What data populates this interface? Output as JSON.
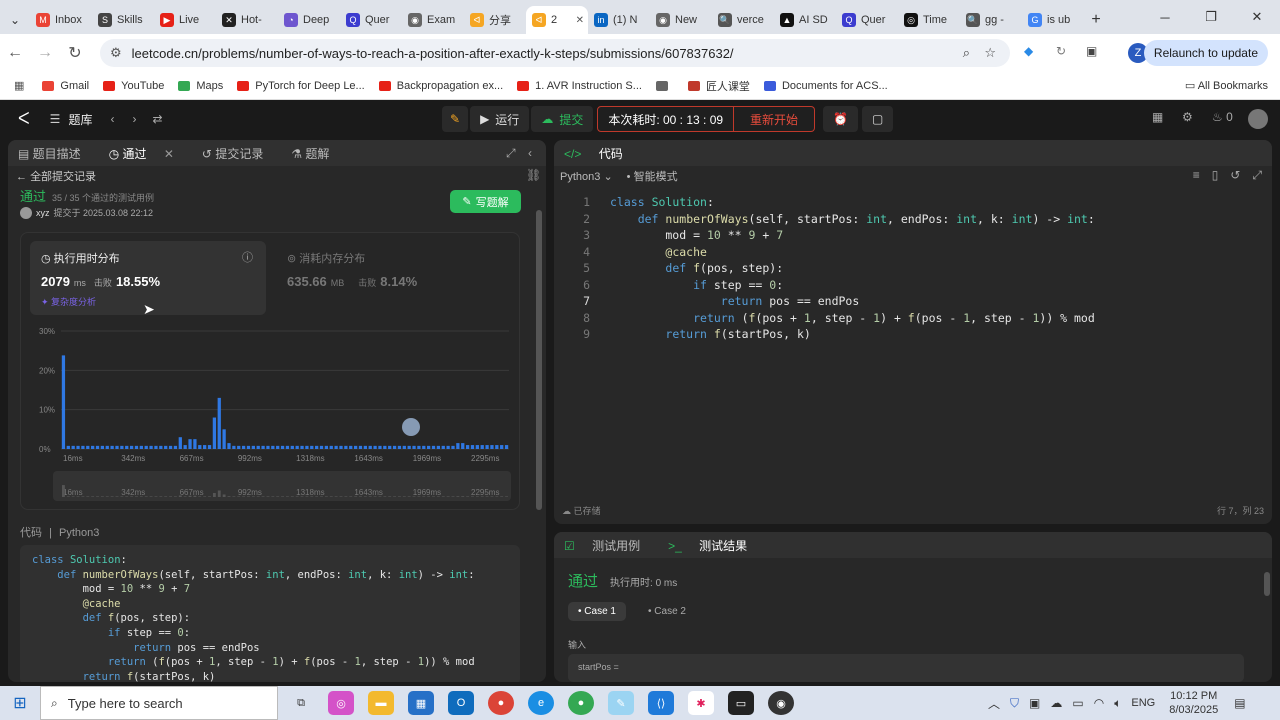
{
  "browser": {
    "tabs": [
      {
        "label": "Inbox",
        "color": "#ea4335",
        "glyph": "M"
      },
      {
        "label": "Skills",
        "color": "#444",
        "glyph": "S"
      },
      {
        "label": "Live",
        "color": "#e62117",
        "glyph": "▶"
      },
      {
        "label": "Hot-",
        "color": "#222",
        "glyph": "✕"
      },
      {
        "label": "Deep",
        "color": "#6e56cf",
        "glyph": "◔"
      },
      {
        "label": "Quer",
        "color": "#3c3ccf",
        "glyph": "Q"
      },
      {
        "label": "Exam",
        "color": "#666",
        "glyph": "◉"
      },
      {
        "label": "分享",
        "color": "#f5a623",
        "glyph": "ᐊ"
      },
      {
        "label": "2",
        "color": "#f5a623",
        "glyph": "ᐊ",
        "active": true
      },
      {
        "label": "(1) N",
        "color": "#0a66c2",
        "glyph": "in"
      },
      {
        "label": "New",
        "color": "#666",
        "glyph": "◉"
      },
      {
        "label": "verce",
        "color": "#555",
        "glyph": "🔍"
      },
      {
        "label": "AI SD",
        "color": "#111",
        "glyph": "▲"
      },
      {
        "label": "Quer",
        "color": "#3c3ccf",
        "glyph": "Q"
      },
      {
        "label": "Time",
        "color": "#111",
        "glyph": "◎"
      },
      {
        "label": "gg -",
        "color": "#555",
        "glyph": "🔍"
      },
      {
        "label": "is ub",
        "color": "#4285f4",
        "glyph": "G"
      }
    ],
    "new_tab": "+",
    "url": "leetcode.cn/problems/number-of-ways-to-reach-a-position-after-exactly-k-steps/submissions/607837632/",
    "relaunch": "Relaunch to update",
    "avatar": "Z",
    "bookmarks": [
      {
        "label": "Gmail",
        "color": "#ea4335"
      },
      {
        "label": "YouTube",
        "color": "#e62117"
      },
      {
        "label": "Maps",
        "color": "#34a853"
      },
      {
        "label": "PyTorch for Deep Le...",
        "color": "#e62117"
      },
      {
        "label": "Backpropagation ex...",
        "color": "#e62117"
      },
      {
        "label": "1. AVR Instruction S...",
        "color": "#e62117"
      },
      {
        "label": "",
        "color": "#666"
      },
      {
        "label": "匠人课堂",
        "color": "#c0392b"
      },
      {
        "label": "Documents for ACS...",
        "color": "#3b5bdb"
      }
    ],
    "all_bookmarks": "All Bookmarks"
  },
  "lc": {
    "problem_bank": "题库",
    "run": "运行",
    "submit": "提交",
    "timer_label": "本次耗时: 00 : 13 : 09",
    "restart": "重新开始",
    "counter": "0",
    "left_tabs": [
      "题目描述",
      "通过",
      "提交记录",
      "题解"
    ],
    "back_all": "全部提交记录",
    "status": "通过",
    "passed_cases": "35 / 35 个通过的测试用例",
    "user": "xyz",
    "submitted_at": "提交于 2025.03.08 22:12",
    "write_solution": "写题解",
    "runtime_title": "执行用时分布",
    "runtime_value": "2079",
    "runtime_unit": "ms",
    "beats_label": "击败",
    "runtime_beats": "18.55%",
    "complexity": "复杂度分析",
    "memory_title": "消耗内存分布",
    "memory_value": "635.66",
    "memory_unit": "MB",
    "memory_beats": "8.14%",
    "code_label": "代码",
    "lang": "Python3",
    "right_code_tab": "代码",
    "smart_mode": "智能模式",
    "saved": "已存储",
    "cursor_pos": "行 7，列 23",
    "test_case_tab": "测试用例",
    "test_result_tab": "测试结果",
    "result_status": "通过",
    "result_time": "执行用时: 0 ms",
    "cases": [
      "Case 1",
      "Case 2"
    ],
    "input_label": "输入",
    "input_var": "startPos ="
  },
  "code_lines": [
    "class Solution:",
    "    def numberOfWays(self, startPos: int, endPos: int, k: int) -> int:",
    "        mod = 10 ** 9 + 7",
    "        @cache",
    "        def f(pos, step):",
    "            if step == 0:",
    "                return pos == endPos",
    "            return (f(pos + 1, step - 1) + f(pos - 1, step - 1)) % mod",
    "        return f(startPos, k)"
  ],
  "chart_data": {
    "type": "bar",
    "title": "执行用时分布",
    "ylabel": "",
    "ylim": [
      0,
      30
    ],
    "yticks": [
      "30%",
      "20%",
      "10%",
      "0%"
    ],
    "xticks": [
      "16ms",
      "342ms",
      "667ms",
      "992ms",
      "1318ms",
      "1643ms",
      "1969ms",
      "2295ms"
    ],
    "values": [
      23.8,
      0.8,
      0.8,
      0.8,
      0.8,
      0.8,
      0.8,
      0.8,
      0.8,
      0.8,
      0.8,
      0.8,
      0.8,
      0.8,
      0.8,
      0.8,
      0.8,
      0.8,
      0.8,
      0.8,
      0.8,
      0.8,
      0.8,
      0.8,
      3,
      1,
      2.5,
      2.5,
      1,
      1,
      1,
      8,
      13,
      5,
      1.5,
      0.8,
      0.8,
      0.8,
      0.8,
      0.8,
      0.8,
      0.8,
      0.8,
      0.8,
      0.8,
      0.8,
      0.8,
      0.8,
      0.8,
      0.8,
      0.8,
      0.8,
      0.8,
      0.8,
      0.8,
      0.8,
      0.8,
      0.8,
      0.8,
      0.8,
      0.8,
      0.8,
      0.8,
      0.8,
      0.8,
      0.8,
      0.8,
      0.8,
      0.8,
      0.8,
      0.8,
      0.8,
      0.8,
      0.8,
      0.8,
      0.8,
      0.8,
      0.8,
      0.8,
      0.8,
      0.8,
      1.5,
      1.5,
      1,
      1,
      1,
      1,
      1,
      1,
      1,
      1,
      1
    ],
    "highlight_color": "#2f78e3"
  },
  "taskbar": {
    "search_placeholder": "Type here to search",
    "lang": "ENG",
    "time": "10:12 PM",
    "date": "8/03/2025"
  }
}
